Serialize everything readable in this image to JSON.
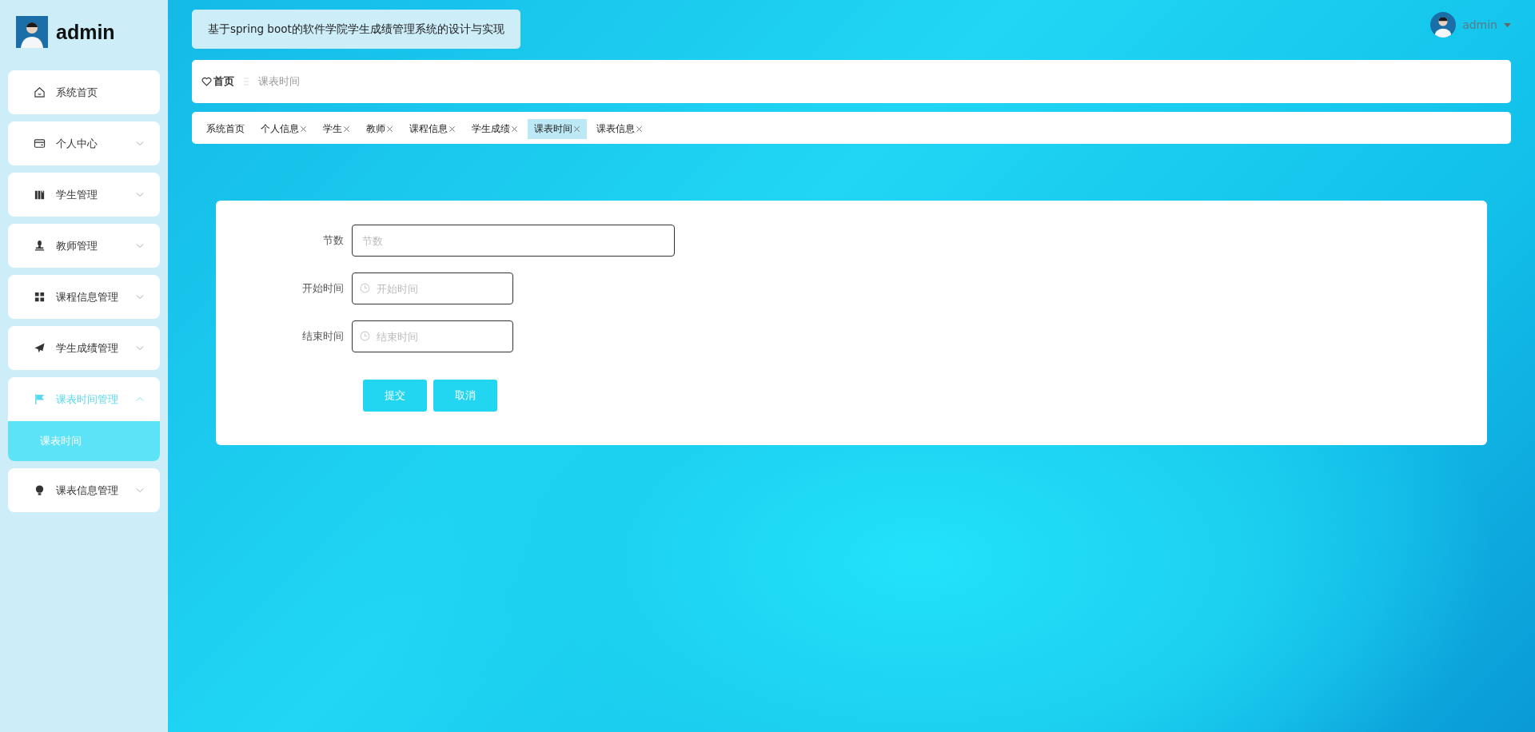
{
  "sidebar": {
    "user": "admin",
    "items": [
      {
        "label": "系统首页",
        "selected": false
      },
      {
        "label": "个人中心",
        "selected": false,
        "expanded": false
      },
      {
        "label": "学生管理",
        "selected": false,
        "expanded": false
      },
      {
        "label": "教师管理",
        "selected": false,
        "expanded": false
      },
      {
        "label": "课程信息管理",
        "selected": false,
        "expanded": false
      },
      {
        "label": "学生成绩管理",
        "selected": false,
        "expanded": false
      },
      {
        "label": "课表时间管理",
        "selected": true,
        "expanded": true,
        "children": [
          {
            "label": "课表时间",
            "selected": true
          }
        ]
      },
      {
        "label": "课表信息管理",
        "selected": false,
        "expanded": false
      }
    ]
  },
  "header": {
    "title": "基于spring boot的软件学院学生成绩管理系统的设计与实现",
    "user": "admin"
  },
  "breadcrumb": [
    {
      "label": "首页"
    },
    {
      "label": "课表时间"
    }
  ],
  "tabs": [
    {
      "label": "系统首页",
      "closable": false,
      "selected": false
    },
    {
      "label": "个人信息",
      "closable": true,
      "selected": false
    },
    {
      "label": "学生",
      "closable": true,
      "selected": false
    },
    {
      "label": "教师",
      "closable": true,
      "selected": false
    },
    {
      "label": "课程信息",
      "closable": true,
      "selected": false
    },
    {
      "label": "学生成绩",
      "closable": true,
      "selected": false
    },
    {
      "label": "课表时间",
      "closable": true,
      "selected": true
    },
    {
      "label": "课表信息",
      "closable": true,
      "selected": false
    }
  ],
  "form": {
    "fields": [
      {
        "kind": "text",
        "label": "节数",
        "placeholder": "节数"
      },
      {
        "kind": "time",
        "label": "开始时间",
        "placeholder": "开始时间"
      },
      {
        "kind": "time",
        "label": "结束时间",
        "placeholder": "结束时间"
      }
    ],
    "buttons": [
      "提交",
      "取消"
    ]
  }
}
